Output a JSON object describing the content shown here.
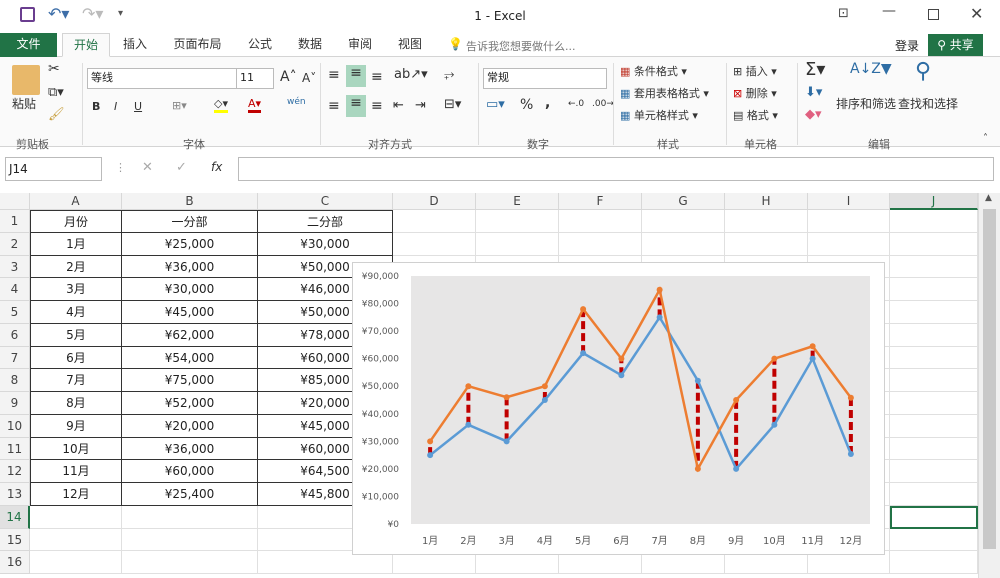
{
  "titlebar": {
    "title": "1 - Excel"
  },
  "tabs": [
    "文件",
    "开始",
    "插入",
    "页面布局",
    "公式",
    "数据",
    "审阅",
    "视图"
  ],
  "tellme": "告诉我您想要做什么...",
  "login": "登录",
  "share": "共享",
  "ribbon": {
    "paste": "粘贴",
    "clipboard": "剪贴板",
    "font_name": "等线",
    "font_size": "11",
    "font_group": "字体",
    "align_group": "对齐方式",
    "number_format": "常规",
    "number_group": "数字",
    "cond_format": "条件格式",
    "table_format": "套用表格格式",
    "cell_style": "单元格样式",
    "style_group": "样式",
    "insert": "插入",
    "delete": "删除",
    "format": "格式",
    "cells_group": "单元格",
    "sort": "排序和筛选",
    "find": "查找和选择",
    "edit_group": "编辑",
    "bold": "B",
    "italic": "I",
    "underline": "U",
    "wen": "wén",
    "percent": "%",
    "comma": ","
  },
  "formula_bar": {
    "name_box": "J14",
    "value": ""
  },
  "columns": [
    "A",
    "B",
    "C",
    "D",
    "E",
    "F",
    "G",
    "H",
    "I",
    "J"
  ],
  "rows": [
    "1",
    "2",
    "3",
    "4",
    "5",
    "6",
    "7",
    "8",
    "9",
    "10",
    "11",
    "12",
    "13",
    "14",
    "15",
    "16"
  ],
  "table": {
    "headers": [
      "月份",
      "一分部",
      "二分部"
    ],
    "rows": [
      [
        "1月",
        "¥25,000",
        "¥30,000"
      ],
      [
        "2月",
        "¥36,000",
        "¥50,000"
      ],
      [
        "3月",
        "¥30,000",
        "¥46,000"
      ],
      [
        "4月",
        "¥45,000",
        "¥50,000"
      ],
      [
        "5月",
        "¥62,000",
        "¥78,000"
      ],
      [
        "6月",
        "¥54,000",
        "¥60,000"
      ],
      [
        "7月",
        "¥75,000",
        "¥85,000"
      ],
      [
        "8月",
        "¥52,000",
        "¥20,000"
      ],
      [
        "9月",
        "¥20,000",
        "¥45,000"
      ],
      [
        "10月",
        "¥36,000",
        "¥60,000"
      ],
      [
        "11月",
        "¥60,000",
        "¥64,500"
      ],
      [
        "12月",
        "¥25,400",
        "¥45,800"
      ]
    ]
  },
  "chart_data": {
    "type": "line",
    "categories": [
      "1月",
      "2月",
      "3月",
      "4月",
      "5月",
      "6月",
      "7月",
      "8月",
      "9月",
      "10月",
      "11月",
      "12月"
    ],
    "series": [
      {
        "values": [
          25000,
          36000,
          30000,
          45000,
          62000,
          54000,
          75000,
          52000,
          20000,
          36000,
          60000,
          25400
        ],
        "color": "#5b9bd5"
      },
      {
        "values": [
          30000,
          50000,
          46000,
          50000,
          78000,
          60000,
          85000,
          20000,
          45000,
          60000,
          64500,
          45800
        ],
        "color": "#ed7d31"
      }
    ],
    "drop_lines": {
      "style": "dashed",
      "color": "#c00000"
    },
    "ylim": [
      0,
      90000
    ],
    "yticks": [
      "¥0",
      "¥10,000",
      "¥20,000",
      "¥30,000",
      "¥40,000",
      "¥50,000",
      "¥60,000",
      "¥70,000",
      "¥80,000",
      "¥90,000"
    ],
    "plot_background": "#e7e6e6",
    "grid": false
  },
  "colors": {
    "accent": "#217346"
  }
}
